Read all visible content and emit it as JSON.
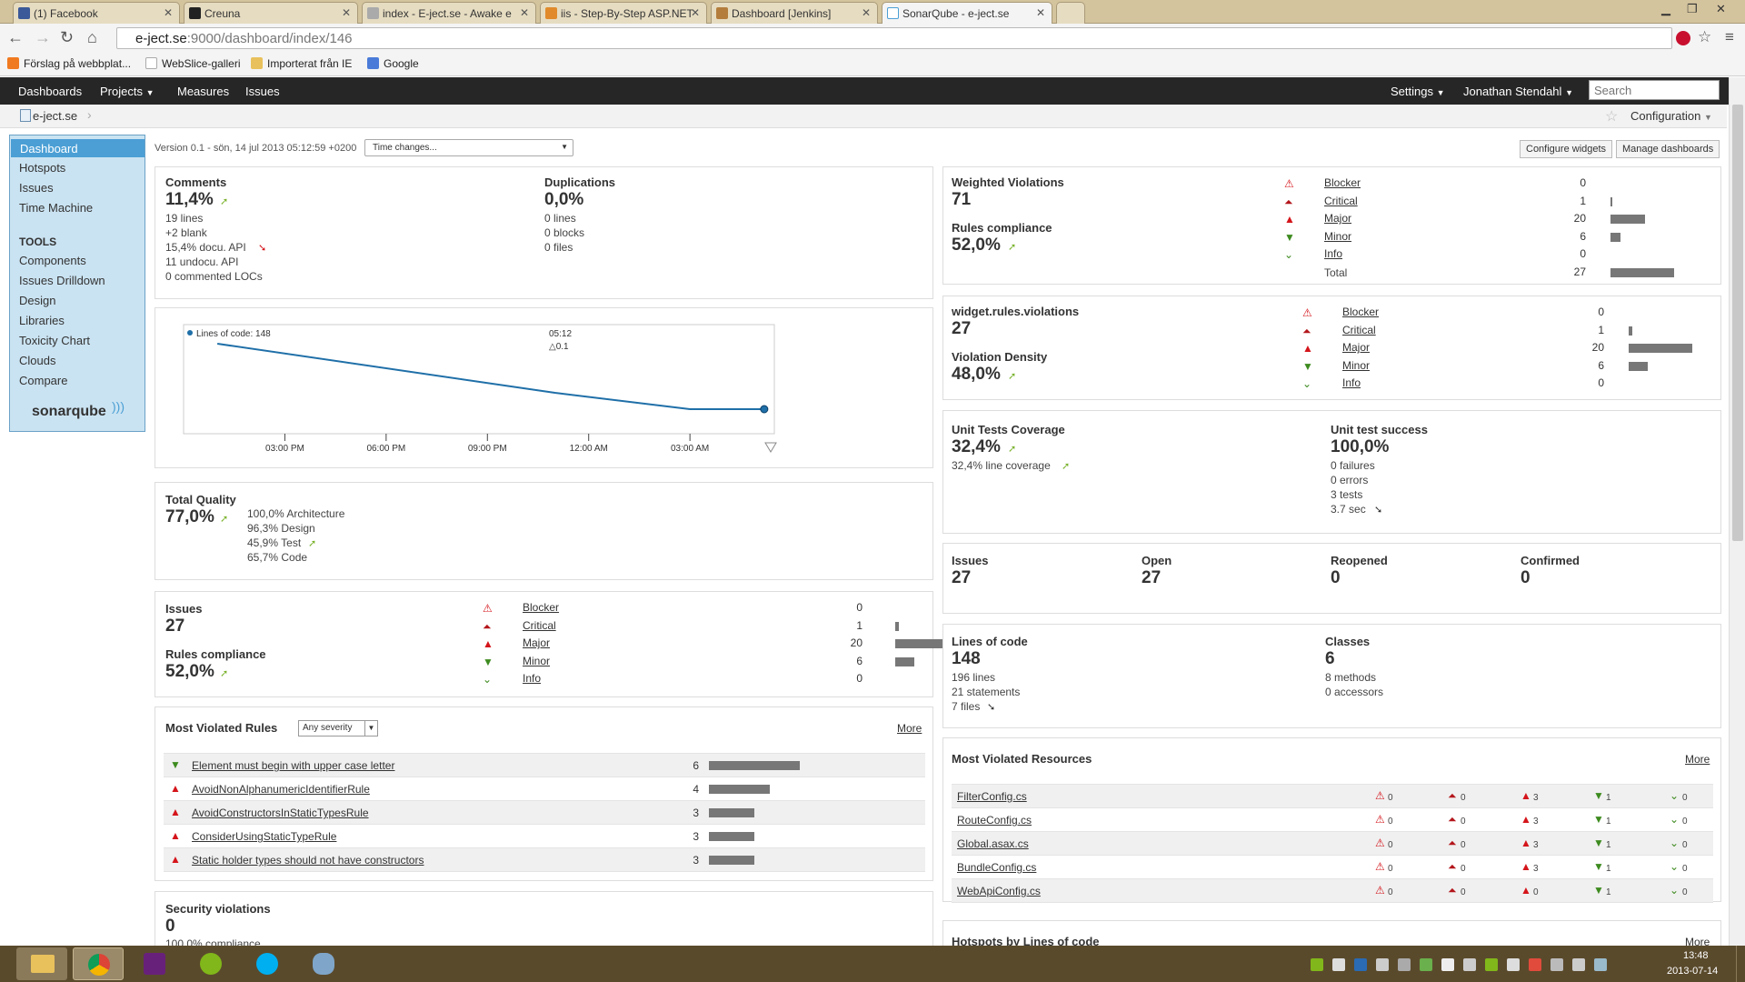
{
  "browser": {
    "tabs": [
      {
        "label": "(1) Facebook",
        "color": "#3b5998"
      },
      {
        "label": "Creuna",
        "color": "#222"
      },
      {
        "label": "index - E-ject.se - Awake e",
        "color": "#8a8a8a"
      },
      {
        "label": "iis - Step-By-Step ASP.NET",
        "color": "#e08a2c"
      },
      {
        "label": "Dashboard [Jenkins]",
        "color": "#b47d3c"
      },
      {
        "label": "SonarQube - e-ject.se",
        "color": "#4b9fd5"
      }
    ],
    "url_host": "e-ject.se",
    "url_path": ":9000/dashboard/index/146",
    "bookmarks": [
      "Förslag på webbplat...",
      "WebSlice-galleri",
      "Importerat från IE",
      "Google"
    ]
  },
  "nav": {
    "items": [
      "Dashboards",
      "Projects",
      "Measures",
      "Issues"
    ],
    "settings": "Settings",
    "user": "Jonathan Stendahl",
    "search_placeholder": "Search",
    "configuration": "Configuration",
    "project": "e-ject.se"
  },
  "sidebar": {
    "items": [
      "Dashboard",
      "Hotspots",
      "Issues",
      "Time Machine"
    ],
    "tools_label": "TOOLS",
    "tools": [
      "Components",
      "Issues Drilldown",
      "Design",
      "Libraries",
      "Toxicity Chart",
      "Clouds",
      "Compare"
    ],
    "logo": "sonarqube"
  },
  "version": "Version 0.1 - sön, 14 jul 2013 05:12:59 +0200",
  "time_changes": "Time changes...",
  "configure_widgets": "Configure widgets",
  "manage_dashboards": "Manage dashboards",
  "comments": {
    "label": "Comments",
    "value": "11,4%",
    "lines": [
      "19 lines",
      "+2 blank",
      "15,4% docu. API",
      "11 undocu. API",
      "0 commented LOCs"
    ]
  },
  "duplications": {
    "label": "Duplications",
    "value": "0,0%",
    "lines": [
      "0 lines",
      "0 blocks",
      "0 files"
    ]
  },
  "chart_data": {
    "type": "line",
    "title": "",
    "legend": "Lines of code: 148",
    "event_time": "05:12",
    "event_version": "0.1",
    "x_ticks": [
      "03:00 PM",
      "06:00 PM",
      "09:00 PM",
      "12:00 AM",
      "03:00 AM"
    ],
    "series": [
      {
        "name": "Lines of code",
        "points": [
          [
            "13:00",
            196
          ],
          [
            "23:00",
            160
          ],
          [
            "03:00",
            148
          ],
          [
            "05:12",
            148
          ]
        ]
      }
    ],
    "xlabel": "",
    "ylabel": ""
  },
  "total_quality": {
    "label": "Total Quality",
    "value": "77,0%",
    "lines": [
      "100,0% Architecture",
      "96,3% Design",
      "45,9% Test",
      "65,7% Code"
    ]
  },
  "issues_widget": {
    "label": "Issues",
    "value": "27",
    "rc_label": "Rules compliance",
    "rc_value": "52,0%",
    "rows": [
      {
        "name": "Blocker",
        "count": "0",
        "ratio": 0
      },
      {
        "name": "Critical",
        "count": "1",
        "ratio": 0.05
      },
      {
        "name": "Major",
        "count": "20",
        "ratio": 1
      },
      {
        "name": "Minor",
        "count": "6",
        "ratio": 0.3
      },
      {
        "name": "Info",
        "count": "0",
        "ratio": 0
      }
    ]
  },
  "most_violated_rules": {
    "label": "Most Violated Rules",
    "filter": "Any severity",
    "more": "More",
    "rows": [
      {
        "sev": "minor",
        "name": "Element must begin with upper case letter",
        "count": "6",
        "ratio": 1
      },
      {
        "sev": "major",
        "name": "AvoidNonAlphanumericIdentifierRule",
        "count": "4",
        "ratio": 0.67
      },
      {
        "sev": "major",
        "name": "AvoidConstructorsInStaticTypesRule",
        "count": "3",
        "ratio": 0.5
      },
      {
        "sev": "major",
        "name": "ConsiderUsingStaticTypeRule",
        "count": "3",
        "ratio": 0.5
      },
      {
        "sev": "major",
        "name": "Static holder types should not have constructors",
        "count": "3",
        "ratio": 0.5
      }
    ]
  },
  "security": {
    "label": "Security violations",
    "value": "0",
    "sub": "100,0% compliance"
  },
  "weighted": {
    "label": "Weighted Violations",
    "value": "71",
    "rc_label": "Rules compliance",
    "rc_value": "52,0%",
    "rows": [
      {
        "name": "Blocker",
        "count": "0",
        "ratio": 0
      },
      {
        "name": "Critical",
        "count": "1",
        "ratio": 0.04
      },
      {
        "name": "Major",
        "count": "20",
        "ratio": 0.74
      },
      {
        "name": "Minor",
        "count": "6",
        "ratio": 0.22
      },
      {
        "name": "Info",
        "count": "0",
        "ratio": 0
      }
    ],
    "total_label": "Total",
    "total": "27",
    "total_ratio": 1
  },
  "rules_violations": {
    "label": "widget.rules.violations",
    "value": "27",
    "vd_label": "Violation Density",
    "vd_value": "48,0%",
    "rows": [
      {
        "name": "Blocker",
        "count": "0",
        "ratio": 0
      },
      {
        "name": "Critical",
        "count": "1",
        "ratio": 0.05
      },
      {
        "name": "Major",
        "count": "20",
        "ratio": 1
      },
      {
        "name": "Minor",
        "count": "6",
        "ratio": 0.3
      },
      {
        "name": "Info",
        "count": "0",
        "ratio": 0
      }
    ]
  },
  "tests": {
    "cov_label": "Unit Tests Coverage",
    "cov_value": "32,4%",
    "cov_line": "32,4% line coverage",
    "succ_label": "Unit test success",
    "succ_value": "100,0%",
    "succ_lines": [
      "0 failures",
      "0 errors",
      "3 tests",
      "3.7 sec"
    ]
  },
  "issue_counts": [
    {
      "label": "Issues",
      "value": "27"
    },
    {
      "label": "Open",
      "value": "27"
    },
    {
      "label": "Reopened",
      "value": "0"
    },
    {
      "label": "Confirmed",
      "value": "0"
    }
  ],
  "size": {
    "loc_label": "Lines of code",
    "loc_value": "148",
    "loc_lines": [
      "196 lines",
      "21 statements",
      "7 files"
    ],
    "classes_label": "Classes",
    "classes_value": "6",
    "classes_lines": [
      "8 methods",
      "0 accessors"
    ]
  },
  "most_violated_resources": {
    "label": "Most Violated Resources",
    "more": "More",
    "rows": [
      {
        "name": "FilterConfig.cs",
        "v": [
          "0",
          "0",
          "3",
          "1",
          "0"
        ]
      },
      {
        "name": "RouteConfig.cs",
        "v": [
          "0",
          "0",
          "3",
          "1",
          "0"
        ]
      },
      {
        "name": "Global.asax.cs",
        "v": [
          "0",
          "0",
          "3",
          "1",
          "0"
        ]
      },
      {
        "name": "BundleConfig.cs",
        "v": [
          "0",
          "0",
          "3",
          "1",
          "0"
        ]
      },
      {
        "name": "WebApiConfig.cs",
        "v": [
          "0",
          "0",
          "0",
          "1",
          "0"
        ]
      }
    ]
  },
  "hotspots": {
    "label": "Hotspots by Lines of code",
    "more": "More"
  },
  "clock": {
    "time": "13:48",
    "date": "2013-07-14"
  }
}
